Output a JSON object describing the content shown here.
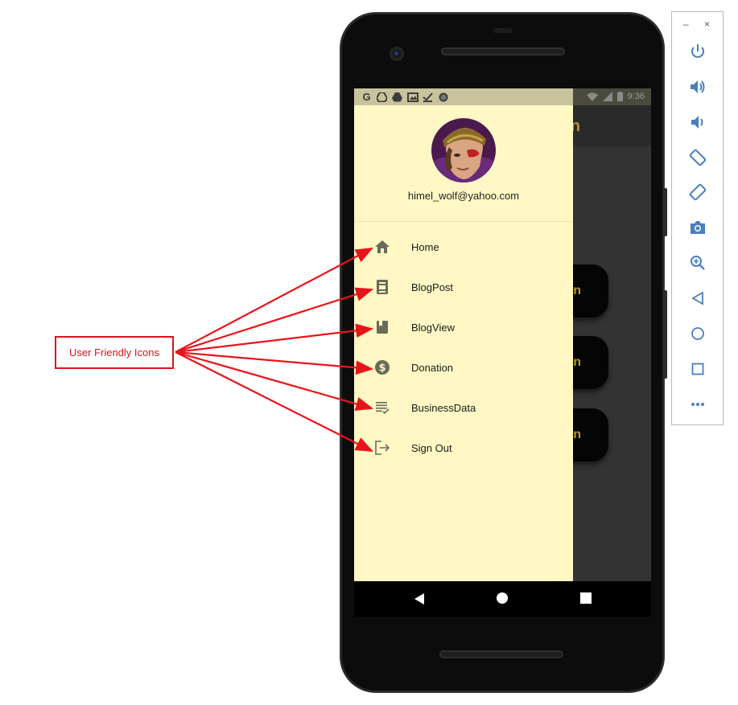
{
  "annotation": {
    "label": "User Friendly Icons",
    "arrow_color": "#e8141b"
  },
  "status_bar": {
    "time": "9:36",
    "notification_icons": [
      "G",
      "drive-icon",
      "drive-icon",
      "image-icon",
      "check-icon",
      "circle-icon"
    ]
  },
  "background_app": {
    "title_fragment": "n",
    "buttons": [
      "n",
      "on",
      "on"
    ],
    "accent_color": "#b8962a"
  },
  "drawer": {
    "background_color": "#fff8c4",
    "email": "himel_wolf@yahoo.com",
    "items": [
      {
        "label": "Home",
        "icon": "home-icon"
      },
      {
        "label": "BlogPost",
        "icon": "blog-post-icon"
      },
      {
        "label": "BlogView",
        "icon": "book-icon"
      },
      {
        "label": "Donation",
        "icon": "dollar-icon"
      },
      {
        "label": "BusinessData",
        "icon": "list-check-icon"
      },
      {
        "label": "Sign Out",
        "icon": "logout-icon"
      }
    ]
  },
  "emulator_toolbar": {
    "window_controls": [
      "–",
      "×"
    ],
    "buttons": [
      "power-icon",
      "volume-up-icon",
      "volume-down-icon",
      "rotate-left-icon",
      "rotate-right-icon",
      "camera-icon",
      "zoom-icon",
      "back-icon",
      "home-icon",
      "overview-icon",
      "more-icon"
    ]
  }
}
